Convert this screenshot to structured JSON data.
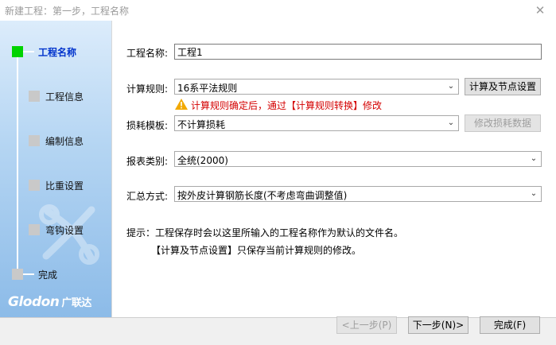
{
  "window": {
    "title": "新建工程：第一步，工程名称",
    "close_glyph": "✕"
  },
  "sidebar": {
    "steps": [
      {
        "label": "工程名称",
        "active": true
      },
      {
        "label": "工程信息"
      },
      {
        "label": "编制信息"
      },
      {
        "label": "比重设置"
      },
      {
        "label": "弯钩设置"
      },
      {
        "label": "完成"
      }
    ],
    "logo_text": "Glodon",
    "logo_cn": "广联达"
  },
  "form": {
    "project_name_label": "工程名称:",
    "project_name_value": "工程1",
    "calc_rule_label": "计算规则:",
    "calc_rule_value": "16系平法规则",
    "calc_settings_button": "计算及节点设置",
    "warning_text": "计算规则确定后，通过【计算规则转换】修改",
    "loss_template_label": "损耗模板:",
    "loss_template_value": "不计算损耗",
    "modify_loss_button": "修改损耗数据",
    "report_type_label": "报表类别:",
    "report_type_value": "全统(2000)",
    "summary_label": "汇总方式:",
    "summary_value": "按外皮计算钢筋长度(不考虑弯曲调整值)"
  },
  "hints": {
    "line1": "提示：工程保存时会以这里所输入的工程名称作为默认的文件名。",
    "line2": "【计算及节点设置】只保存当前计算规则的修改。"
  },
  "footer": {
    "prev_button": "<上一步(P)",
    "next_button": "下一步(N)>",
    "finish_button": "完成(F)"
  },
  "colors": {
    "active_step": "#00d300",
    "warning": "#d40000",
    "sidebar_top": "#dcecfb",
    "sidebar_bottom": "#8cbbe8"
  },
  "icons": {
    "warning": "warning-triangle-icon",
    "close": "close-icon",
    "dropdown": "chevron-down-icon"
  }
}
